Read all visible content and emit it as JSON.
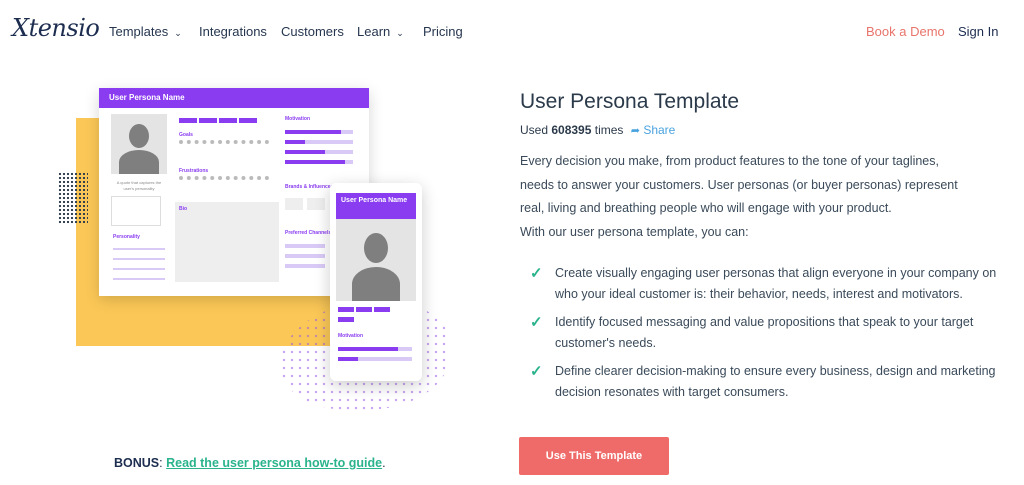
{
  "nav": {
    "logo": "Xtensio",
    "items": [
      {
        "label": "Templates",
        "has_dropdown": true
      },
      {
        "label": "Integrations",
        "has_dropdown": false
      },
      {
        "label": "Customers",
        "has_dropdown": false
      },
      {
        "label": "Learn",
        "has_dropdown": true
      },
      {
        "label": "Pricing",
        "has_dropdown": false
      }
    ],
    "caret_icon": "chevron-down-icon",
    "book_demo": "Book a Demo",
    "sign_in": "Sign In"
  },
  "illustration": {
    "doc_title": "User Persona Name",
    "phone_title": "User Persona Name",
    "sections": [
      "Goals",
      "Frustrations",
      "Bio",
      "Motivation",
      "Brands & Influencers",
      "Preferred Channels",
      "Personality"
    ],
    "quote": "A quote that captures the user's personality",
    "accent_color": "#8a3cf0",
    "yellow_color": "#fbc857"
  },
  "bonus": {
    "label": "BONUS",
    "link": "Read the user persona how-to guide",
    "suffix": "."
  },
  "main": {
    "title": "User Persona Template",
    "used_prefix": "Used",
    "used_count": "608395",
    "used_suffix": "times",
    "share": "Share",
    "description": [
      "Every decision you make, from product features to the tone of your taglines,",
      "needs to answer your customers. User personas (or buyer personas) represent",
      "real, living and breathing people who will engage with your product.",
      "With our user persona template, you can:"
    ],
    "checklist": [
      "Create visually engaging user personas that align everyone in your company on who your ideal customer is: their behavior, needs, interest and motivators.",
      "Identify focused messaging and value propositions that speak to your target customer's needs.",
      "Define clearer decision-making to ensure every business, design and marketing decision resonates with target consumers."
    ],
    "cta": "Use This Template",
    "cta_color": "#ef6b69",
    "check_color": "#2ab38c"
  }
}
